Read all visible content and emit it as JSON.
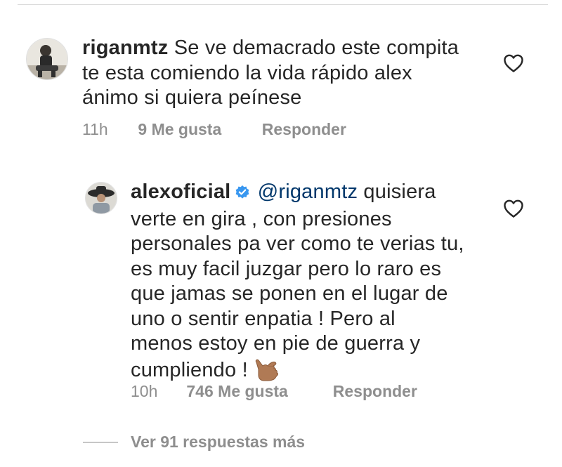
{
  "comment1": {
    "username": "riganmtz",
    "lines": [
      "Se ve demacrado este compita",
      "te esta comiendo la vida rápido alex",
      "ánimo si quiera peínese"
    ],
    "time": "11h",
    "likes": "9 Me gusta",
    "reply_label": "Responder"
  },
  "comment2": {
    "username": "alexoficial",
    "mention": "@riganmtz",
    "first_line_rest": " quisiera",
    "lines": [
      "verte en gira , con presiones",
      "personales pa ver como te verias tu,",
      "es muy facil juzgar pero lo raro es",
      "que jamas se ponen en el lugar de",
      "uno o sentir enpatia !  Pero al",
      "menos estoy en pie de guerra y"
    ],
    "last_line": "cumpliendo !",
    "time": "10h",
    "likes": "746 Me gusta",
    "reply_label": "Responder",
    "emoji": "call-me-hand-emoji"
  },
  "view_replies": {
    "label": "Ver 91 respuestas más"
  },
  "icons": {
    "like": "heart-outline-icon",
    "verified": "verified-badge-icon"
  },
  "colors": {
    "text": "#262626",
    "meta": "#8e8e8e",
    "mention": "#00376b",
    "verified": "#3897f0"
  }
}
